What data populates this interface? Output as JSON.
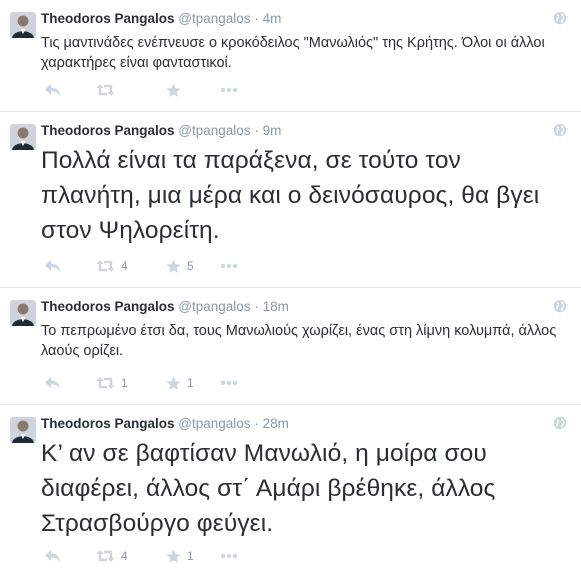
{
  "tweets": [
    {
      "fullname": "Theodoros Pangalos",
      "handle": "@tpangalos",
      "dot": "·",
      "time": "4m",
      "text": "Τις μαντινάδες ενέπνευσε ο κροκόδειλος \"Μανωλιός\" της Κρήτης. Όλοι οι άλλοι χαρακτήρες είναι φανταστικοί.",
      "retweets": "",
      "favorites": "",
      "large": false
    },
    {
      "fullname": "Theodoros Pangalos",
      "handle": "@tpangalos",
      "dot": "·",
      "time": "9m",
      "text": "Πολλά είναι τα παράξενα, σε τούτο τον πλανήτη, μια μέρα και ο δεινόσαυρος, θα βγει στον Ψηλορείτη.",
      "retweets": "4",
      "favorites": "5",
      "large": true
    },
    {
      "fullname": "Theodoros Pangalos",
      "handle": "@tpangalos",
      "dot": "·",
      "time": "18m",
      "text": "Το πεπρωμένο έτσι δα, τους Μανωλιούς χωρίζει, ένας στη λίμνη κολυμπά, άλλος λαούς ορίζει.",
      "retweets": "1",
      "favorites": "1",
      "large": false
    },
    {
      "fullname": "Theodoros Pangalos",
      "handle": "@tpangalos",
      "dot": "·",
      "time": "28m",
      "text": "Κ’ αν σε βαφτίσαν Μανωλιό, η μοίρα σου διαφέρει, άλλος στ΄ Αμάρι βρέθηκε, άλλος Στρασβούργο φεύγει.",
      "retweets": "4",
      "favorites": "1",
      "large": true
    }
  ],
  "icons": {
    "reply": "reply-icon",
    "retweet": "retweet-icon",
    "favorite": "star-icon",
    "more": "more-icon",
    "globe": "globe-icon"
  },
  "colors": {
    "icon": "#ccd6dd",
    "meta": "#8899a6",
    "text": "#292f33",
    "divider": "#e1e8ed"
  }
}
